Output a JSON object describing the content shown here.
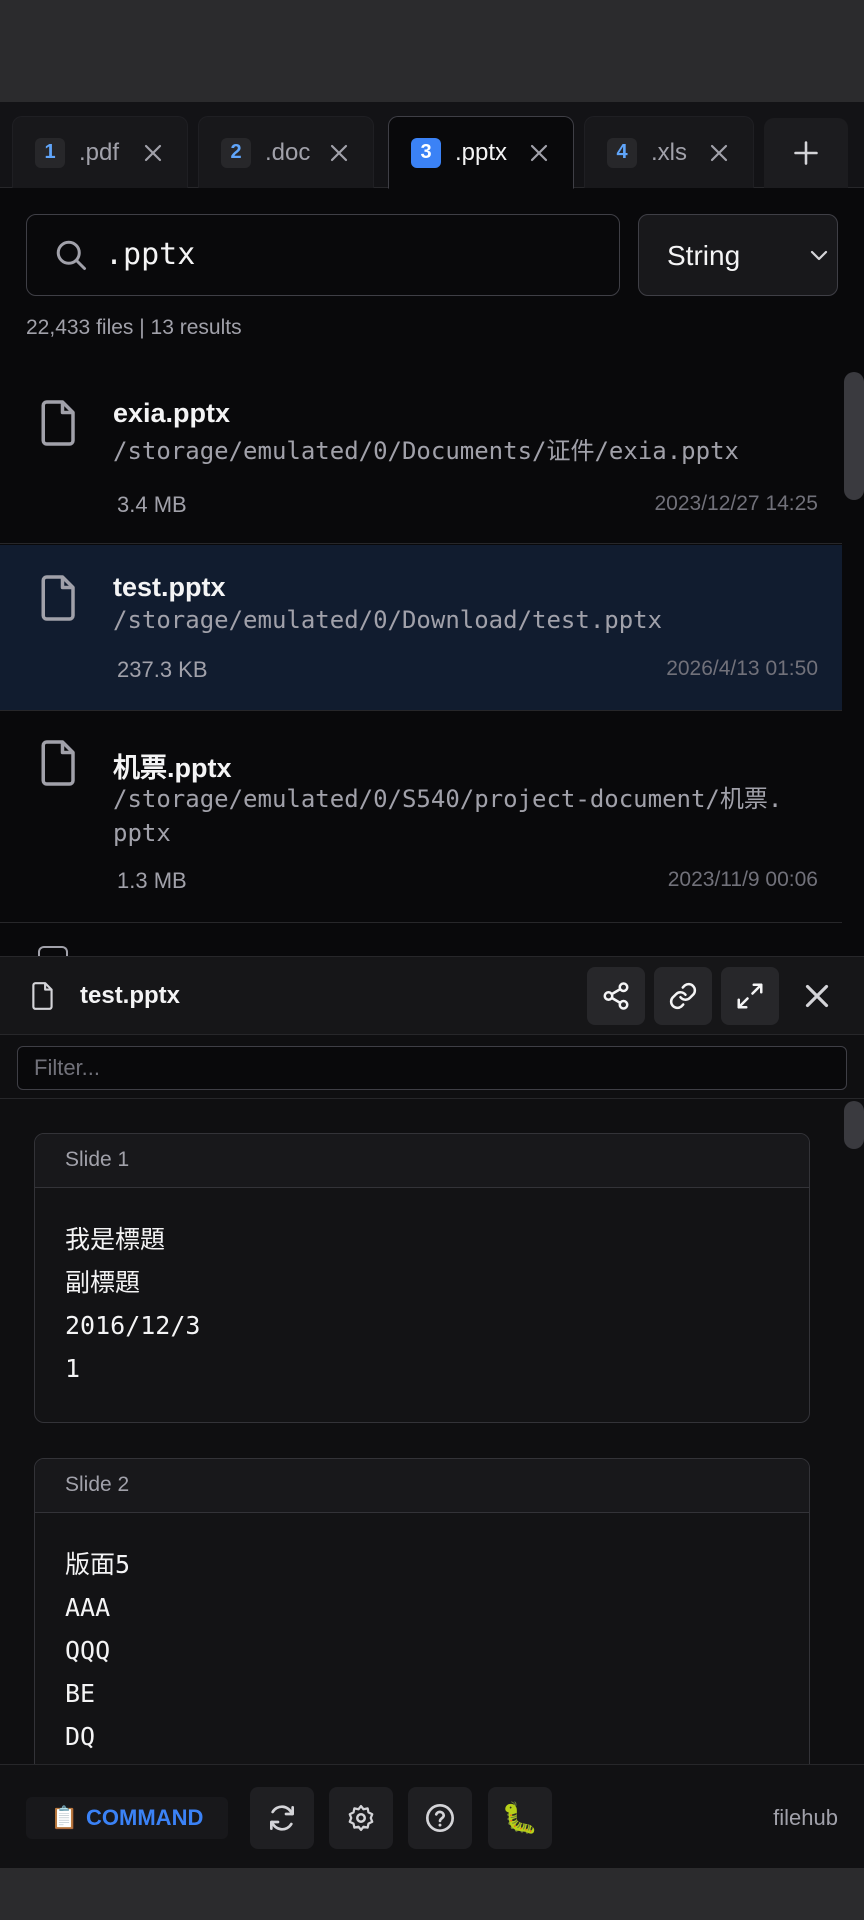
{
  "tabs": [
    {
      "num": "1",
      "label": ".pdf",
      "active": false
    },
    {
      "num": "2",
      "label": ".doc",
      "active": false
    },
    {
      "num": "3",
      "label": ".pptx",
      "active": true
    },
    {
      "num": "4",
      "label": ".xls",
      "active": false
    }
  ],
  "search": {
    "query": ".pptx",
    "mode": "String"
  },
  "status": {
    "summary": "22,433 files | 13 results"
  },
  "results": [
    {
      "name": "exia.pptx",
      "path": "/storage/emulated/0/Documents/证件/exia.pptx",
      "size": "3.4 MB",
      "date": "2023/12/27 14:25"
    },
    {
      "name": "test.pptx",
      "path": "/storage/emulated/0/Download/test.pptx",
      "size": "237.3 KB",
      "date": "2026/4/13 01:50",
      "selected": true
    },
    {
      "name": "机票.pptx",
      "path_line1": "/storage/emulated/0/S540/project-document/机票.",
      "path_line2": "pptx",
      "size": "1.3 MB",
      "date": "2023/11/9 00:06"
    }
  ],
  "preview": {
    "title": "test.pptx",
    "filter_placeholder": "Filter...",
    "slides": [
      {
        "header": "Slide 1",
        "lines": [
          "我是標題",
          "副標題",
          "2016/12/3",
          "1"
        ]
      },
      {
        "header": "Slide 2",
        "lines": [
          "版面5",
          "AAA",
          "QQQ",
          "BE",
          "DQ"
        ]
      }
    ]
  },
  "footer": {
    "command_icon": "📋",
    "command_label": "COMMAND",
    "debug_icon": "🐛",
    "brand": "filehub"
  },
  "colors": {
    "accent": "#3b82f6",
    "background": "#09090b",
    "selected_row": "#111c2f"
  },
  "icons": [
    "search-icon",
    "chevron-down-icon",
    "file-icon",
    "close-icon",
    "plus-icon",
    "share-icon",
    "link-icon",
    "expand-icon",
    "refresh-icon",
    "gear-icon",
    "help-icon",
    "bug-icon"
  ]
}
